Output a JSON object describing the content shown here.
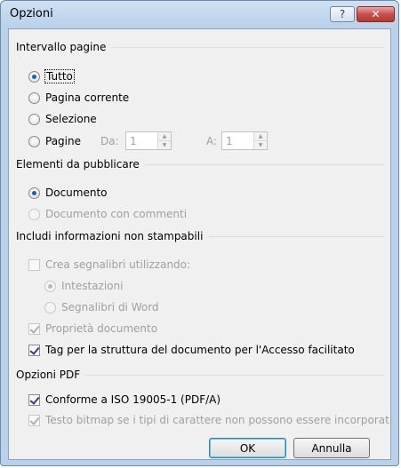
{
  "window": {
    "title": "Opzioni",
    "help_glyph": "?",
    "close_glyph": "✕"
  },
  "range": {
    "heading": "Intervallo pagine",
    "all": "Tutto",
    "current": "Pagina corrente",
    "selection": "Selezione",
    "pages": "Pagine",
    "from_label": "Da:",
    "from_value": "1",
    "to_label": "A:",
    "to_value": "1"
  },
  "publish": {
    "heading": "Elementi da pubblicare",
    "document": "Documento",
    "document_comments": "Documento con commenti"
  },
  "nonprint": {
    "heading": "Includi informazioni non stampabili",
    "bookmarks": "Crea segnalibri utilizzando:",
    "headings": "Intestazioni",
    "word_bookmarks": "Segnalibri di Word",
    "properties": "Proprietà documento",
    "tags": "Tag per la struttura del documento per l'Accesso facilitato"
  },
  "pdf": {
    "heading": "Opzioni PDF",
    "iso": "Conforme a ISO 19005-1 (PDF/A)",
    "bitmap": "Testo bitmap se i tipi di carattere non possono essere incorporati"
  },
  "buttons": {
    "ok": "OK",
    "cancel": "Annulla"
  },
  "colors": {
    "accent": "#1e5cc8",
    "close_button": "#c75050",
    "frame": "#b9d1ea"
  }
}
